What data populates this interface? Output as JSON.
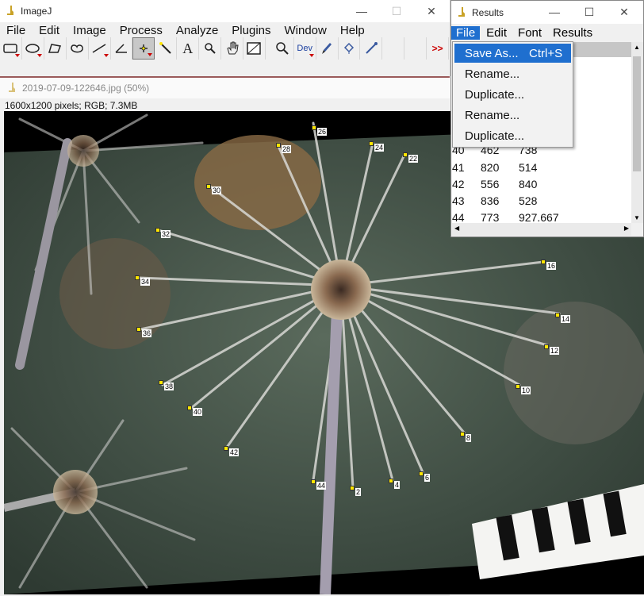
{
  "imagej": {
    "title": "ImageJ",
    "menu": [
      "File",
      "Edit",
      "Image",
      "Process",
      "Analyze",
      "Plugins",
      "Window",
      "Help"
    ],
    "tools": [
      "rectangle-tool",
      "oval-tool",
      "polygon-tool",
      "freehand-tool",
      "line-tool",
      "angle-tool",
      "multipoint-tool",
      "wand-tool",
      "text-tool",
      "magnifier-tool",
      "hand-tool",
      "color-picker-tool",
      "zoom-tool",
      "dev-menu",
      "brush-tool",
      "flood-fill-tool",
      "pencil-tool",
      "more-tools"
    ],
    "dev_label": "Dev",
    "more_label": ">>"
  },
  "image_window": {
    "title": "2019-07-09-122646.jpg (50%)",
    "info": "1600x1200 pixels; RGB; 7.3MB"
  },
  "results": {
    "title": "Results",
    "menu": [
      "File",
      "Edit",
      "Font",
      "Results"
    ],
    "rows": [
      {
        "n": "40",
        "x": "462",
        "y": "738"
      },
      {
        "n": "41",
        "x": "820",
        "y": "514"
      },
      {
        "n": "42",
        "x": "556",
        "y": "840"
      },
      {
        "n": "43",
        "x": "836",
        "y": "528"
      },
      {
        "n": "44",
        "x": "773",
        "y": "927.667"
      }
    ]
  },
  "file_menu": [
    {
      "label": "Save As...",
      "shortcut": "Ctrl+S"
    },
    {
      "label": "Rename...",
      "shortcut": ""
    },
    {
      "label": "Duplicate...",
      "shortcut": ""
    },
    {
      "label": "Rename...",
      "shortcut": ""
    },
    {
      "label": "Duplicate...",
      "shortcut": ""
    }
  ],
  "markers": [
    "26",
    "28",
    "24",
    "22",
    "30",
    "32",
    "34",
    "36",
    "38",
    "40",
    "42",
    "44",
    "2",
    "4",
    "6",
    "8",
    "10",
    "12",
    "14",
    "16"
  ],
  "colors": {
    "selection": "#1f6fcf",
    "marker": "#ffe600",
    "title_accent": "#9a5a5a"
  }
}
